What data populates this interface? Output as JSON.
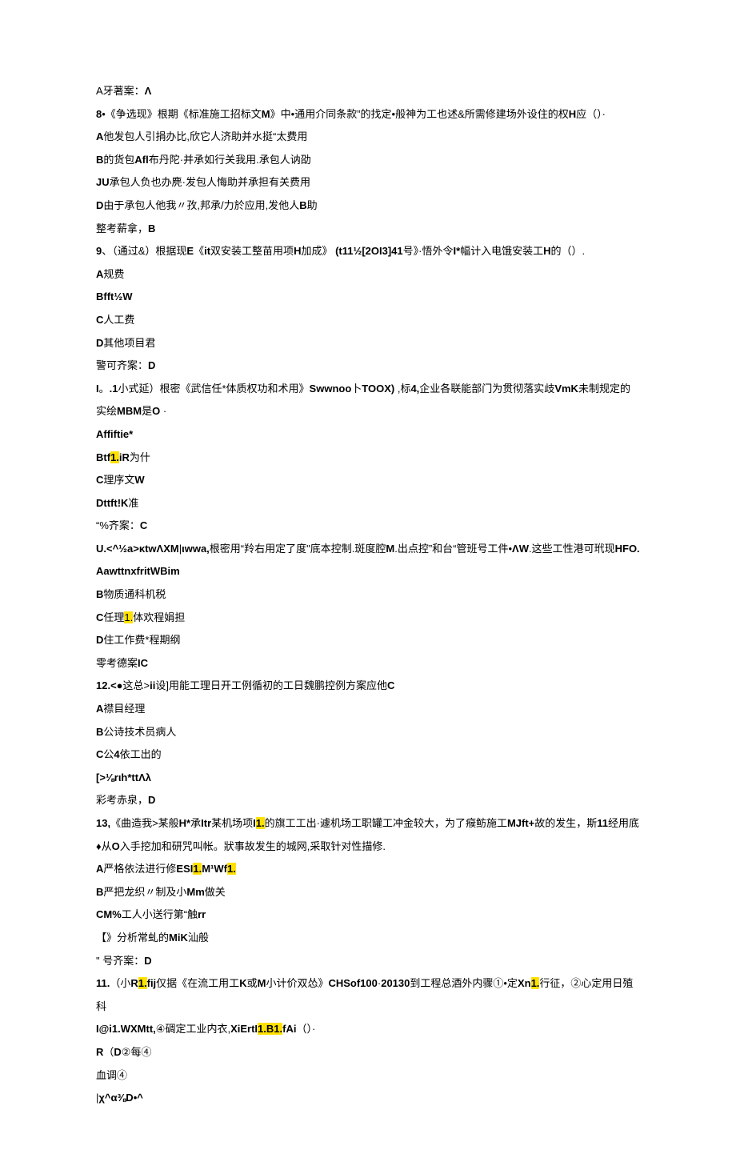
{
  "lines": [
    {
      "segments": [
        {
          "t": "A牙著案：",
          "b": false,
          "h": false
        },
        {
          "t": "Λ",
          "b": true,
          "h": false
        }
      ]
    },
    {
      "segments": [
        {
          "t": "8",
          "b": true,
          "h": false
        },
        {
          "t": "•《争选现》根期《标准施工招标文",
          "b": false,
          "h": false
        },
        {
          "t": "M",
          "b": true,
          "h": false
        },
        {
          "t": "》中•通用介同条款”的找定•般神为工也述&所需修建场外设住的权",
          "b": false,
          "h": false
        },
        {
          "t": "H",
          "b": true,
          "h": false
        },
        {
          "t": "应（）·",
          "b": false,
          "h": false
        }
      ]
    },
    {
      "segments": [
        {
          "t": "A",
          "b": true,
          "h": false
        },
        {
          "t": "他发包人引捐办比,欣它人济助并水挺“太费用",
          "b": false,
          "h": false
        }
      ]
    },
    {
      "segments": [
        {
          "t": "B",
          "b": true,
          "h": false
        },
        {
          "t": "的货包",
          "b": false,
          "h": false
        },
        {
          "t": "Afl",
          "b": true,
          "h": false
        },
        {
          "t": "布丹陀·并承如行关我用.承包人讷劭",
          "b": false,
          "h": false
        }
      ]
    },
    {
      "segments": [
        {
          "t": "JU",
          "b": true,
          "h": false
        },
        {
          "t": "承包人负也办麂·发包人悔助并承担有关费用",
          "b": false,
          "h": false
        }
      ]
    },
    {
      "segments": [
        {
          "t": "D",
          "b": true,
          "h": false
        },
        {
          "t": "由于承包人他我〃孜,邦承/力於应用,发他人",
          "b": false,
          "h": false
        },
        {
          "t": "B",
          "b": true,
          "h": false
        },
        {
          "t": "助",
          "b": false,
          "h": false
        }
      ]
    },
    {
      "segments": [
        {
          "t": "整考薪拿，",
          "b": false,
          "h": false
        },
        {
          "t": "B",
          "b": true,
          "h": false
        }
      ]
    },
    {
      "segments": [
        {
          "t": "9",
          "b": true,
          "h": false
        },
        {
          "t": "、（通过&）根据现",
          "b": false,
          "h": false
        },
        {
          "t": "E",
          "b": true,
          "h": false
        },
        {
          "t": "《",
          "b": false,
          "h": false
        },
        {
          "t": "it",
          "b": true,
          "h": false
        },
        {
          "t": "双安装工整苗用项",
          "b": false,
          "h": false
        },
        {
          "t": "H",
          "b": true,
          "h": false
        },
        {
          "t": "加成》 ",
          "b": false,
          "h": false
        },
        {
          "t": "(t11½[2OI3]41",
          "b": true,
          "h": false
        },
        {
          "t": "号》·悟外令",
          "b": false,
          "h": false
        },
        {
          "t": "I*",
          "b": true,
          "h": false
        },
        {
          "t": "幅计入电饿安装工",
          "b": false,
          "h": false
        },
        {
          "t": "H",
          "b": true,
          "h": false
        },
        {
          "t": "的（）.",
          "b": false,
          "h": false
        }
      ]
    },
    {
      "segments": [
        {
          "t": "A",
          "b": true,
          "h": false
        },
        {
          "t": "规费",
          "b": false,
          "h": false
        }
      ]
    },
    {
      "segments": [
        {
          "t": "Bfft½W",
          "b": true,
          "h": false
        }
      ]
    },
    {
      "segments": [
        {
          "t": "C",
          "b": true,
          "h": false
        },
        {
          "t": "人工费",
          "b": false,
          "h": false
        }
      ]
    },
    {
      "segments": [
        {
          "t": "D",
          "b": true,
          "h": false
        },
        {
          "t": "其他项目君",
          "b": false,
          "h": false
        }
      ]
    },
    {
      "segments": [
        {
          "t": "警可齐案：",
          "b": false,
          "h": false
        },
        {
          "t": "D",
          "b": true,
          "h": false
        }
      ]
    },
    {
      "segments": [
        {
          "t": "I",
          "b": true,
          "h": false
        },
        {
          "t": "。",
          "b": false,
          "h": false
        },
        {
          "t": ".1",
          "b": true,
          "h": false
        },
        {
          "t": "小式延）根密《武信任*体质权功和术用》",
          "b": false,
          "h": false
        },
        {
          "t": "Swwnoo",
          "b": true,
          "h": false
        },
        {
          "t": "卜",
          "b": false,
          "h": false
        },
        {
          "t": "TOOX)",
          "b": true,
          "h": false
        },
        {
          "t": " ,标",
          "b": false,
          "h": false
        },
        {
          "t": "4,",
          "b": true,
          "h": false
        },
        {
          "t": "企业各联能部门为贯彻落实歧",
          "b": false,
          "h": false
        },
        {
          "t": "VmK",
          "b": true,
          "h": false
        },
        {
          "t": "未制规定的实绘",
          "b": false,
          "h": false
        },
        {
          "t": "MBM",
          "b": true,
          "h": false
        },
        {
          "t": "是",
          "b": false,
          "h": false
        },
        {
          "t": "O",
          "b": true,
          "h": false
        },
        {
          "t": " ·",
          "b": false,
          "h": false
        }
      ]
    },
    {
      "segments": [
        {
          "t": "Affiftie*",
          "b": true,
          "h": false
        }
      ]
    },
    {
      "segments": [
        {
          "t": "Btf",
          "b": true,
          "h": false
        },
        {
          "t": "1.",
          "b": true,
          "h": true
        },
        {
          "t": "iR",
          "b": true,
          "h": false
        },
        {
          "t": "为什",
          "b": false,
          "h": false
        }
      ]
    },
    {
      "segments": [
        {
          "t": "C",
          "b": true,
          "h": false
        },
        {
          "t": "理序文",
          "b": false,
          "h": false
        },
        {
          "t": "W",
          "b": true,
          "h": false
        }
      ]
    },
    {
      "segments": [
        {
          "t": "Dttft!K",
          "b": true,
          "h": false
        },
        {
          "t": "准",
          "b": false,
          "h": false
        }
      ]
    },
    {
      "segments": [
        {
          "t": "“%齐案：",
          "b": false,
          "h": false
        },
        {
          "t": "C",
          "b": true,
          "h": false
        }
      ]
    },
    {
      "segments": [
        {
          "t": "U.<^½a>κtwΛXM",
          "b": true,
          "h": false
        },
        {
          "t": "|",
          "b": false,
          "h": false
        },
        {
          "t": "ιwwa,",
          "b": true,
          "h": false
        },
        {
          "t": "根密用“羚右用定了度\"底本控制.斑度腔",
          "b": false,
          "h": false
        },
        {
          "t": "M",
          "b": true,
          "h": false
        },
        {
          "t": ".出点控”和台“管班号工件•",
          "b": false,
          "h": false
        },
        {
          "t": "ΛW",
          "b": true,
          "h": false
        },
        {
          "t": ".这些工性港可玳现",
          "b": false,
          "h": false
        },
        {
          "t": "HFO.",
          "b": true,
          "h": false
        }
      ]
    },
    {
      "segments": [
        {
          "t": "AawttnxfritWBim",
          "b": true,
          "h": false
        }
      ]
    },
    {
      "segments": [
        {
          "t": "B",
          "b": true,
          "h": false
        },
        {
          "t": "物质通科机税",
          "b": false,
          "h": false
        }
      ]
    },
    {
      "segments": [
        {
          "t": "C",
          "b": true,
          "h": false
        },
        {
          "t": "任理",
          "b": false,
          "h": false
        },
        {
          "t": "1.",
          "b": false,
          "h": true
        },
        {
          "t": "体欢程娟担",
          "b": false,
          "h": false
        }
      ]
    },
    {
      "segments": [
        {
          "t": "D",
          "b": true,
          "h": false
        },
        {
          "t": "住工作费*程期纲",
          "b": false,
          "h": false
        }
      ]
    },
    {
      "segments": [
        {
          "t": "零考德案",
          "b": false,
          "h": false
        },
        {
          "t": "IC",
          "b": true,
          "h": false
        }
      ]
    },
    {
      "segments": [
        {
          "t": "12.<●",
          "b": true,
          "h": false
        },
        {
          "t": "这总>",
          "b": false,
          "h": false
        },
        {
          "t": "ii",
          "b": true,
          "h": false
        },
        {
          "t": "设]用能工理日开工例循初的工日魏鹏控例方案应他",
          "b": false,
          "h": false
        },
        {
          "t": "C",
          "b": true,
          "h": false
        }
      ]
    },
    {
      "segments": [
        {
          "t": "A",
          "b": true,
          "h": false
        },
        {
          "t": "襟目经理",
          "b": false,
          "h": false
        }
      ]
    },
    {
      "segments": [
        {
          "t": "B",
          "b": true,
          "h": false
        },
        {
          "t": "公诗技术员病人",
          "b": false,
          "h": false
        }
      ]
    },
    {
      "segments": [
        {
          "t": "C",
          "b": true,
          "h": false
        },
        {
          "t": "公",
          "b": false,
          "h": false
        },
        {
          "t": "4",
          "b": true,
          "h": false
        },
        {
          "t": "依工出的",
          "b": false,
          "h": false
        }
      ]
    },
    {
      "segments": [
        {
          "t": "[>⅛rιh*ttΛλ",
          "b": true,
          "h": false
        }
      ]
    },
    {
      "segments": [
        {
          "t": "彩考赤泉，",
          "b": false,
          "h": false
        },
        {
          "t": "D",
          "b": true,
          "h": false
        }
      ]
    },
    {
      "segments": [
        {
          "t": "13,",
          "b": true,
          "h": false
        },
        {
          "t": "《曲造我>某般",
          "b": false,
          "h": false
        },
        {
          "t": "H*",
          "b": true,
          "h": false
        },
        {
          "t": "承",
          "b": false,
          "h": false
        },
        {
          "t": "Itr",
          "b": true,
          "h": false
        },
        {
          "t": "某机场项",
          "b": false,
          "h": false
        },
        {
          "t": "I",
          "b": true,
          "h": false
        },
        {
          "t": "1.",
          "b": true,
          "h": true
        },
        {
          "t": "的旗工工出·遽机场工职罐工冲金较大，为了瘊鲂施工",
          "b": false,
          "h": false
        },
        {
          "t": "MJft+",
          "b": true,
          "h": false
        },
        {
          "t": "故的发生，斯",
          "b": false,
          "h": false
        },
        {
          "t": "11",
          "b": true,
          "h": false
        },
        {
          "t": "经用底♦从",
          "b": false,
          "h": false
        },
        {
          "t": "O",
          "b": true,
          "h": false
        },
        {
          "t": "入手挖加和研咒叫帐。狀事故发生的城网,采取针对性描修.",
          "b": false,
          "h": false
        }
      ]
    },
    {
      "segments": [
        {
          "t": "A",
          "b": true,
          "h": false
        },
        {
          "t": "严格依法进行修",
          "b": false,
          "h": false
        },
        {
          "t": "ESI",
          "b": true,
          "h": false
        },
        {
          "t": "1.",
          "b": true,
          "h": true
        },
        {
          "t": "M¹Wf",
          "b": true,
          "h": false
        },
        {
          "t": "1.",
          "b": true,
          "h": true
        }
      ]
    },
    {
      "segments": [
        {
          "t": "B",
          "b": true,
          "h": false
        },
        {
          "t": "严把龙织〃制及小",
          "b": false,
          "h": false
        },
        {
          "t": "Mm",
          "b": true,
          "h": false
        },
        {
          "t": "做关",
          "b": false,
          "h": false
        }
      ]
    },
    {
      "segments": [
        {
          "t": "CM%",
          "b": true,
          "h": false
        },
        {
          "t": "工人小送行第“触",
          "b": false,
          "h": false
        },
        {
          "t": "rr",
          "b": true,
          "h": false
        }
      ]
    },
    {
      "segments": [
        {
          "t": "【》分析常虬的",
          "b": false,
          "h": false
        },
        {
          "t": "MiK",
          "b": true,
          "h": false
        },
        {
          "t": "汕般",
          "b": false,
          "h": false
        }
      ]
    },
    {
      "segments": [
        {
          "t": "\" 号齐案：",
          "b": false,
          "h": false
        },
        {
          "t": "D",
          "b": true,
          "h": false
        }
      ]
    },
    {
      "segments": [
        {
          "t": "11.",
          "b": true,
          "h": false
        },
        {
          "t": "（小",
          "b": false,
          "h": false
        },
        {
          "t": "R",
          "b": true,
          "h": false
        },
        {
          "t": "1.",
          "b": true,
          "h": true
        },
        {
          "t": "fij",
          "b": true,
          "h": false
        },
        {
          "t": "仅据《在流工用工",
          "b": false,
          "h": false
        },
        {
          "t": "K",
          "b": true,
          "h": false
        },
        {
          "t": "或",
          "b": false,
          "h": false
        },
        {
          "t": "M",
          "b": true,
          "h": false
        },
        {
          "t": "小计价双怂》",
          "b": false,
          "h": false
        },
        {
          "t": "CHSof100",
          "b": true,
          "h": false
        },
        {
          "t": "·",
          "b": false,
          "h": false
        },
        {
          "t": "20130",
          "b": true,
          "h": false
        },
        {
          "t": "到工程总酒外内骤①•定",
          "b": false,
          "h": false
        },
        {
          "t": "Xn",
          "b": true,
          "h": false
        },
        {
          "t": "1.",
          "b": true,
          "h": true
        },
        {
          "t": "行征，②心定用日殖科",
          "b": false,
          "h": false
        }
      ]
    },
    {
      "segments": [
        {
          "t": "I@i1.WXMtt,",
          "b": true,
          "h": false
        },
        {
          "t": "④碉定工业内衣,",
          "b": false,
          "h": false
        },
        {
          "t": "XiErtI",
          "b": true,
          "h": false
        },
        {
          "t": "1.B1.",
          "b": true,
          "h": true
        },
        {
          "t": "fAi",
          "b": true,
          "h": false
        },
        {
          "t": "（）·",
          "b": false,
          "h": false
        }
      ]
    },
    {
      "segments": [
        {
          "t": "R",
          "b": true,
          "h": false
        },
        {
          "t": "（",
          "b": false,
          "h": false
        },
        {
          "t": "D",
          "b": true,
          "h": false
        },
        {
          "t": "②每④",
          "b": false,
          "h": false
        }
      ]
    },
    {
      "segments": [
        {
          "t": "血调④",
          "b": false,
          "h": false
        }
      ]
    },
    {
      "segments": [
        {
          "t": " |",
          "b": false,
          "h": false
        },
        {
          "t": "χ^α⅜D•^",
          "b": true,
          "h": false
        }
      ]
    }
  ]
}
